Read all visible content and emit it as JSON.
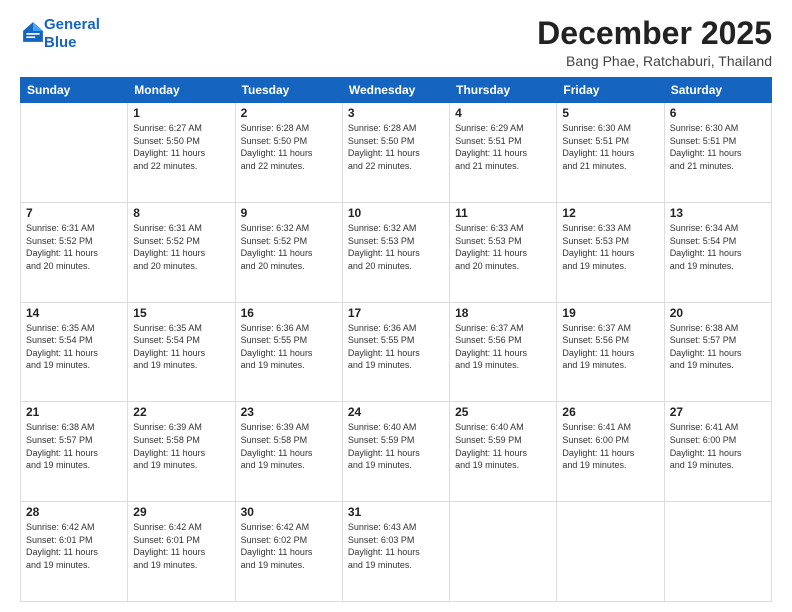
{
  "logo": {
    "line1": "General",
    "line2": "Blue"
  },
  "title": "December 2025",
  "location": "Bang Phae, Ratchaburi, Thailand",
  "days_header": [
    "Sunday",
    "Monday",
    "Tuesday",
    "Wednesday",
    "Thursday",
    "Friday",
    "Saturday"
  ],
  "weeks": [
    [
      {
        "day": "",
        "info": ""
      },
      {
        "day": "1",
        "info": "Sunrise: 6:27 AM\nSunset: 5:50 PM\nDaylight: 11 hours\nand 22 minutes."
      },
      {
        "day": "2",
        "info": "Sunrise: 6:28 AM\nSunset: 5:50 PM\nDaylight: 11 hours\nand 22 minutes."
      },
      {
        "day": "3",
        "info": "Sunrise: 6:28 AM\nSunset: 5:50 PM\nDaylight: 11 hours\nand 22 minutes."
      },
      {
        "day": "4",
        "info": "Sunrise: 6:29 AM\nSunset: 5:51 PM\nDaylight: 11 hours\nand 21 minutes."
      },
      {
        "day": "5",
        "info": "Sunrise: 6:30 AM\nSunset: 5:51 PM\nDaylight: 11 hours\nand 21 minutes."
      },
      {
        "day": "6",
        "info": "Sunrise: 6:30 AM\nSunset: 5:51 PM\nDaylight: 11 hours\nand 21 minutes."
      }
    ],
    [
      {
        "day": "7",
        "info": "Sunrise: 6:31 AM\nSunset: 5:52 PM\nDaylight: 11 hours\nand 20 minutes."
      },
      {
        "day": "8",
        "info": "Sunrise: 6:31 AM\nSunset: 5:52 PM\nDaylight: 11 hours\nand 20 minutes."
      },
      {
        "day": "9",
        "info": "Sunrise: 6:32 AM\nSunset: 5:52 PM\nDaylight: 11 hours\nand 20 minutes."
      },
      {
        "day": "10",
        "info": "Sunrise: 6:32 AM\nSunset: 5:53 PM\nDaylight: 11 hours\nand 20 minutes."
      },
      {
        "day": "11",
        "info": "Sunrise: 6:33 AM\nSunset: 5:53 PM\nDaylight: 11 hours\nand 20 minutes."
      },
      {
        "day": "12",
        "info": "Sunrise: 6:33 AM\nSunset: 5:53 PM\nDaylight: 11 hours\nand 19 minutes."
      },
      {
        "day": "13",
        "info": "Sunrise: 6:34 AM\nSunset: 5:54 PM\nDaylight: 11 hours\nand 19 minutes."
      }
    ],
    [
      {
        "day": "14",
        "info": "Sunrise: 6:35 AM\nSunset: 5:54 PM\nDaylight: 11 hours\nand 19 minutes."
      },
      {
        "day": "15",
        "info": "Sunrise: 6:35 AM\nSunset: 5:54 PM\nDaylight: 11 hours\nand 19 minutes."
      },
      {
        "day": "16",
        "info": "Sunrise: 6:36 AM\nSunset: 5:55 PM\nDaylight: 11 hours\nand 19 minutes."
      },
      {
        "day": "17",
        "info": "Sunrise: 6:36 AM\nSunset: 5:55 PM\nDaylight: 11 hours\nand 19 minutes."
      },
      {
        "day": "18",
        "info": "Sunrise: 6:37 AM\nSunset: 5:56 PM\nDaylight: 11 hours\nand 19 minutes."
      },
      {
        "day": "19",
        "info": "Sunrise: 6:37 AM\nSunset: 5:56 PM\nDaylight: 11 hours\nand 19 minutes."
      },
      {
        "day": "20",
        "info": "Sunrise: 6:38 AM\nSunset: 5:57 PM\nDaylight: 11 hours\nand 19 minutes."
      }
    ],
    [
      {
        "day": "21",
        "info": "Sunrise: 6:38 AM\nSunset: 5:57 PM\nDaylight: 11 hours\nand 19 minutes."
      },
      {
        "day": "22",
        "info": "Sunrise: 6:39 AM\nSunset: 5:58 PM\nDaylight: 11 hours\nand 19 minutes."
      },
      {
        "day": "23",
        "info": "Sunrise: 6:39 AM\nSunset: 5:58 PM\nDaylight: 11 hours\nand 19 minutes."
      },
      {
        "day": "24",
        "info": "Sunrise: 6:40 AM\nSunset: 5:59 PM\nDaylight: 11 hours\nand 19 minutes."
      },
      {
        "day": "25",
        "info": "Sunrise: 6:40 AM\nSunset: 5:59 PM\nDaylight: 11 hours\nand 19 minutes."
      },
      {
        "day": "26",
        "info": "Sunrise: 6:41 AM\nSunset: 6:00 PM\nDaylight: 11 hours\nand 19 minutes."
      },
      {
        "day": "27",
        "info": "Sunrise: 6:41 AM\nSunset: 6:00 PM\nDaylight: 11 hours\nand 19 minutes."
      }
    ],
    [
      {
        "day": "28",
        "info": "Sunrise: 6:42 AM\nSunset: 6:01 PM\nDaylight: 11 hours\nand 19 minutes."
      },
      {
        "day": "29",
        "info": "Sunrise: 6:42 AM\nSunset: 6:01 PM\nDaylight: 11 hours\nand 19 minutes."
      },
      {
        "day": "30",
        "info": "Sunrise: 6:42 AM\nSunset: 6:02 PM\nDaylight: 11 hours\nand 19 minutes."
      },
      {
        "day": "31",
        "info": "Sunrise: 6:43 AM\nSunset: 6:03 PM\nDaylight: 11 hours\nand 19 minutes."
      },
      {
        "day": "",
        "info": ""
      },
      {
        "day": "",
        "info": ""
      },
      {
        "day": "",
        "info": ""
      }
    ]
  ]
}
